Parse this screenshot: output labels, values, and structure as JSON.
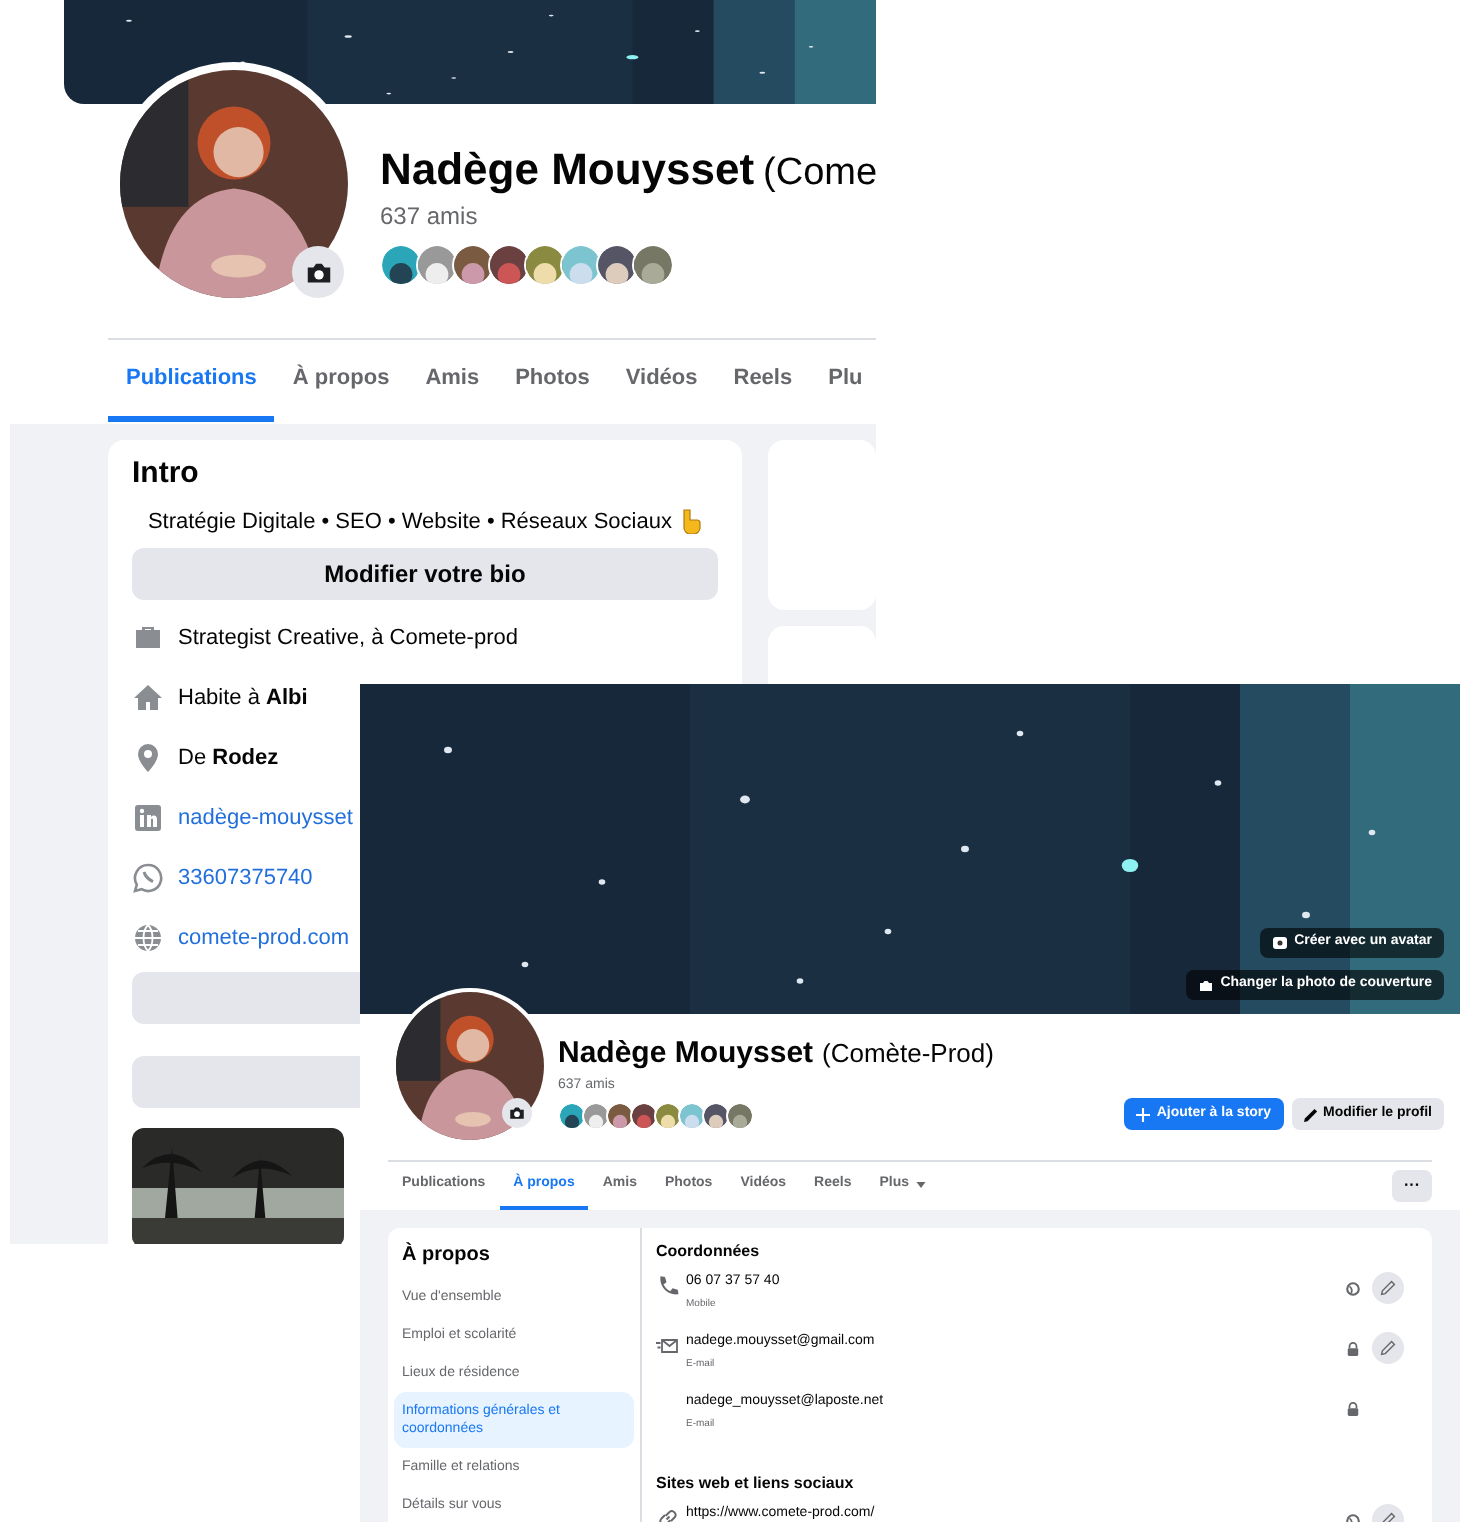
{
  "profile_page": {
    "name": "Nadège Mouysset",
    "name_suffix": "(Come",
    "friends_count": "637 amis",
    "tabs": [
      {
        "label": "Publications",
        "selected": true
      },
      {
        "label": "À propos",
        "selected": false
      },
      {
        "label": "Amis",
        "selected": false
      },
      {
        "label": "Photos",
        "selected": false
      },
      {
        "label": "Vidéos",
        "selected": false
      },
      {
        "label": "Reels",
        "selected": false
      },
      {
        "label": "Plu",
        "selected": false
      }
    ],
    "intro": {
      "title": "Intro",
      "bio": "Stratégie Digitale • SEO • Website • Réseaux Sociaux",
      "edit_bio_button": "Modifier votre bio",
      "details": [
        {
          "kind": "work",
          "text": "Strategist Creative, à Comete-prod"
        },
        {
          "kind": "home",
          "text": "Habite à **Albi**"
        },
        {
          "kind": "origin",
          "text": "De **Rodez**"
        },
        {
          "kind": "linkedin",
          "text": "nadège-mouysset"
        },
        {
          "kind": "whatsapp",
          "text": "33607375740"
        },
        {
          "kind": "website",
          "text": "comete-prod.com"
        }
      ]
    }
  },
  "about_page": {
    "cover_buttons": [
      {
        "kind": "avatar",
        "label": "Créer avec un avatar"
      },
      {
        "kind": "camera",
        "label": "Changer la photo de couverture"
      }
    ],
    "name": "Nadège Mouysset",
    "name_suffix": "(Comète-Prod)",
    "friends_count": "637 amis",
    "actions": [
      {
        "kind": "primary",
        "label": "Ajouter à la story"
      },
      {
        "kind": "secondary",
        "label": "Modifier le profil"
      }
    ],
    "tabs": [
      {
        "label": "Publications",
        "selected": false,
        "dropdown": false
      },
      {
        "label": "À propos",
        "selected": true,
        "dropdown": false
      },
      {
        "label": "Amis",
        "selected": false,
        "dropdown": false
      },
      {
        "label": "Photos",
        "selected": false,
        "dropdown": false
      },
      {
        "label": "Vidéos",
        "selected": false,
        "dropdown": false
      },
      {
        "label": "Reels",
        "selected": false,
        "dropdown": false
      },
      {
        "label": "Plus",
        "selected": false,
        "dropdown": true
      }
    ],
    "more_button": "···",
    "about": {
      "title": "À propos",
      "nav": [
        {
          "label": "Vue d'ensemble",
          "selected": false
        },
        {
          "label": "Emploi et scolarité",
          "selected": false
        },
        {
          "label": "Lieux de résidence",
          "selected": false
        },
        {
          "label": "Informations générales et coordonnées",
          "selected": true
        },
        {
          "label": "Famille et relations",
          "selected": false
        },
        {
          "label": "Détails sur vous",
          "selected": false
        }
      ],
      "sections": [
        {
          "title": "Coordonnées",
          "items": [
            {
              "kind": "phone",
              "value": "06 07 37 57 40",
              "label": "Mobile",
              "public": true,
              "editable": true
            },
            {
              "kind": "email",
              "value": "nadege.mouysset@gmail.com",
              "label": "E-mail",
              "public": false,
              "editable": true
            },
            {
              "value": "nadege_mouysset@laposte.net",
              "label": "E-mail",
              "public": false,
              "editable": false
            }
          ]
        },
        {
          "title": "Sites web et liens sociaux",
          "items": [
            {
              "kind": "link",
              "value": "https://www.comete-prod.com/",
              "public": true,
              "editable": true
            }
          ]
        }
      ]
    }
  }
}
